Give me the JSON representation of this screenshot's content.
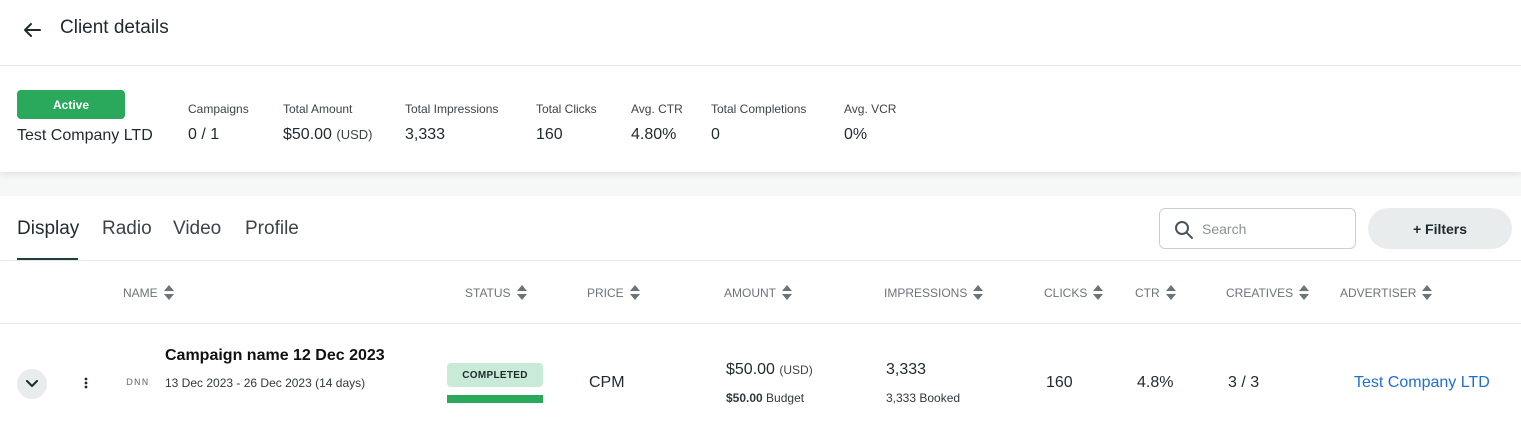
{
  "header": {
    "title": "Client details"
  },
  "summary": {
    "status": "Active",
    "client_name": "Test Company LTD",
    "stats": {
      "campaigns": {
        "label": "Campaigns",
        "value": "0 / 1"
      },
      "total_amount": {
        "label": "Total Amount",
        "value": "$50.00",
        "currency": "(USD)"
      },
      "total_impressions": {
        "label": "Total Impressions",
        "value": "3,333"
      },
      "total_clicks": {
        "label": "Total Clicks",
        "value": "160"
      },
      "avg_ctr": {
        "label": "Avg. CTR",
        "value": "4.80%"
      },
      "total_completions": {
        "label": "Total Completions",
        "value": "0"
      },
      "avg_vcr": {
        "label": "Avg. VCR",
        "value": "0%"
      }
    },
    "status_color": "#2aa85c"
  },
  "tabs": [
    {
      "label": "Display",
      "active": true
    },
    {
      "label": "Radio",
      "active": false
    },
    {
      "label": "Video",
      "active": false
    },
    {
      "label": "Profile",
      "active": false
    }
  ],
  "search": {
    "placeholder": "Search",
    "value": ""
  },
  "filters": {
    "label": "+ Filters"
  },
  "table": {
    "columns": {
      "name": "NAME",
      "status": "STATUS",
      "price": "PRICE",
      "amount": "AMOUNT",
      "impressions": "IMPRESSIONS",
      "clicks": "CLICKS",
      "ctr": "CTR",
      "creatives": "CREATIVES",
      "advertiser": "ADVERTISER"
    },
    "rows": [
      {
        "name": "Campaign name 12 Dec 2023",
        "dates": "13 Dec 2023 - 26 Dec 2023 (14 days)",
        "logo_text": "DNN",
        "status": "COMPLETED",
        "price": "CPM",
        "amount": "$50.00",
        "amount_currency": "(USD)",
        "budget_value": "$50.00",
        "budget_label": "Budget",
        "impressions": "3,333",
        "impressions_booked": "3,333 Booked",
        "clicks": "160",
        "ctr": "4.8%",
        "creatives": "3 / 3",
        "advertiser": "Test Company LTD"
      }
    ]
  },
  "colors": {
    "accent_green": "#2aa85c",
    "link_blue": "#1f6fd1",
    "badge_bg": "#c8ead6"
  }
}
